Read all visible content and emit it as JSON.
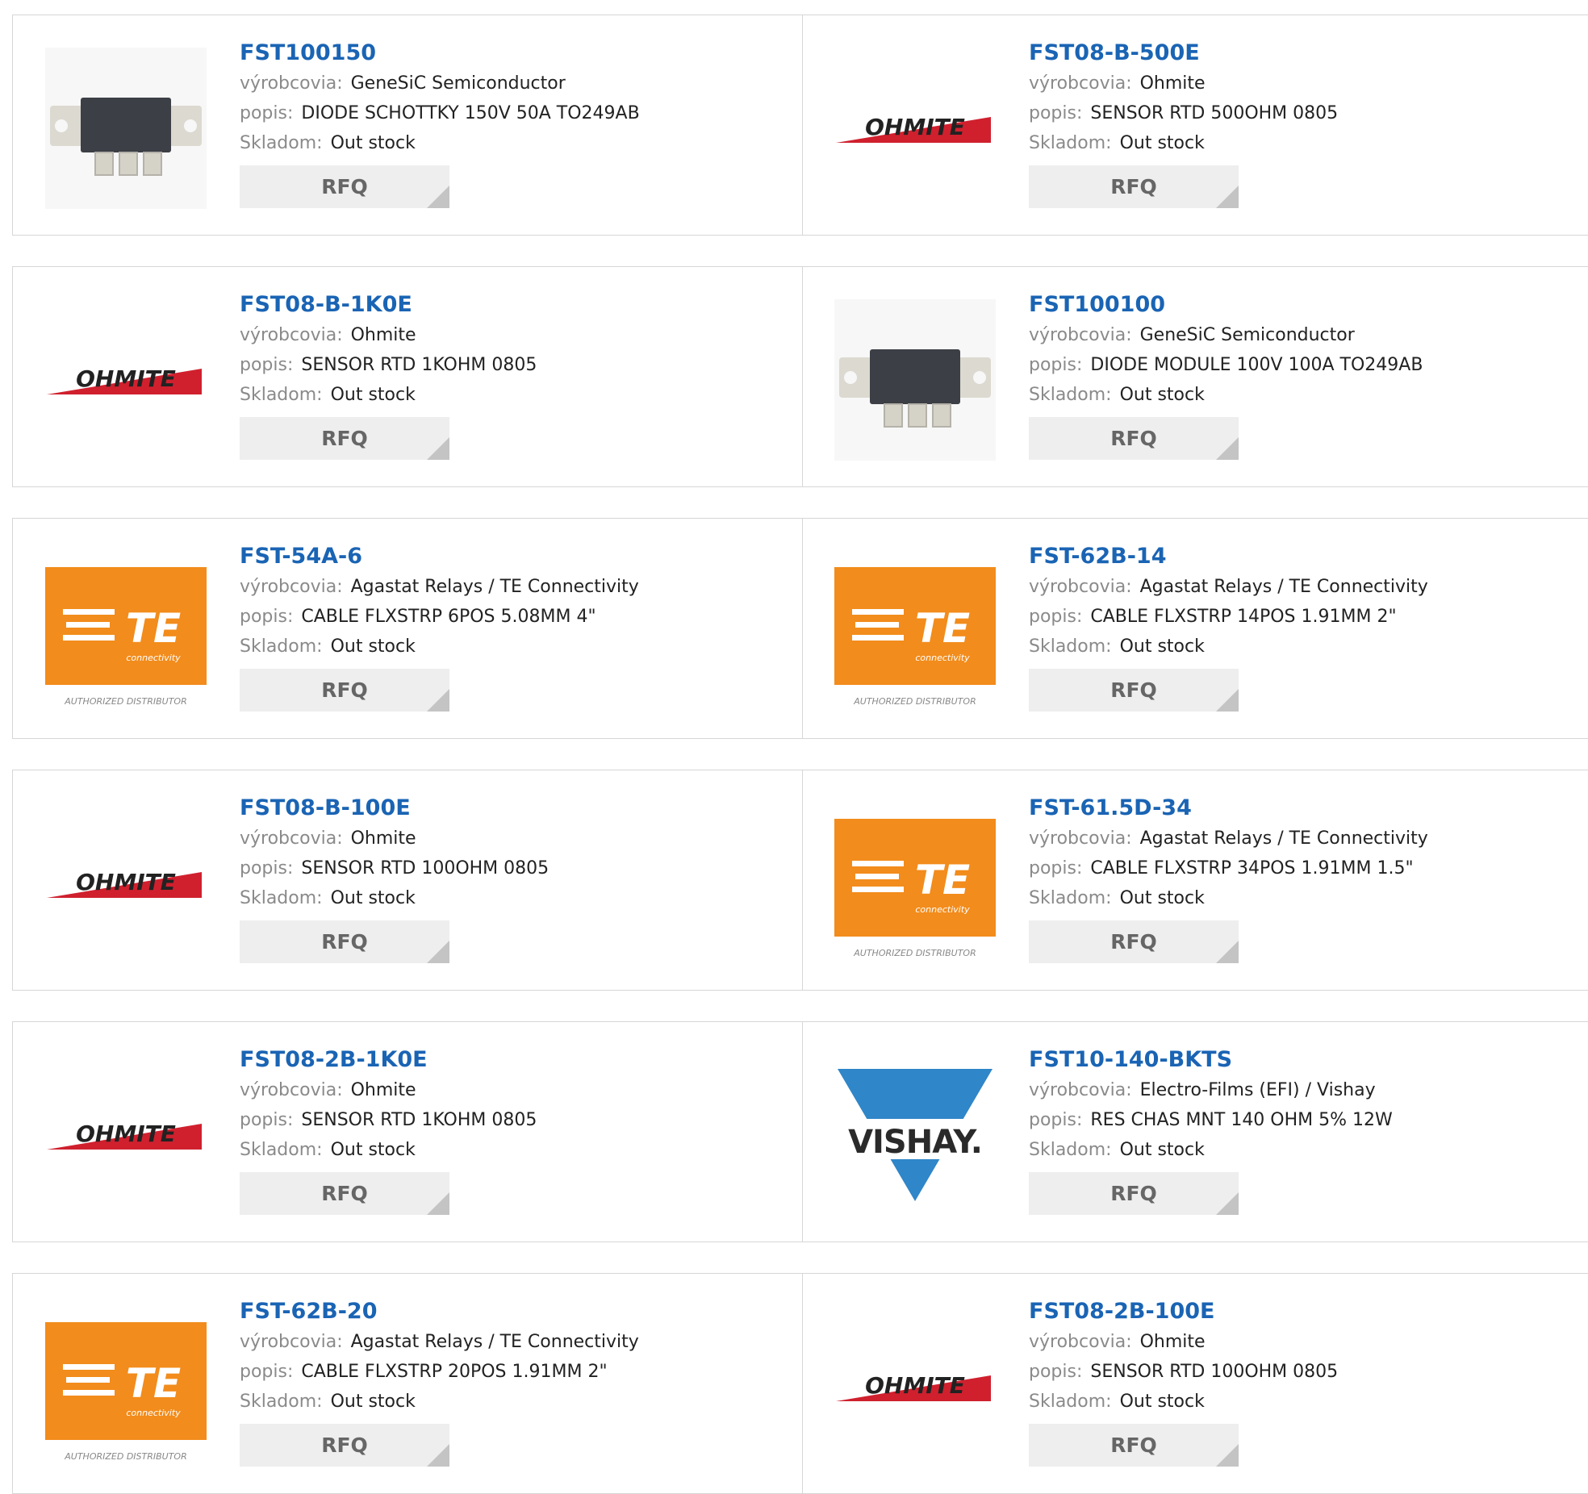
{
  "labels": {
    "manufacturer": "výrobcovia:",
    "description": "popis:",
    "stock": "Skladom:",
    "rfq": "RFQ"
  },
  "logos": {
    "ohmite": "OHMITE",
    "te": "TE",
    "te_sub": "connectivity",
    "te_caption": "AUTHORIZED DISTRIBUTOR",
    "vishay": "VISHAY."
  },
  "colors": {
    "link": "#1a64b4",
    "button_bg": "#eeeeee",
    "te_orange": "#f28c1c",
    "ohmite_red": "#d0202e",
    "vishay_blue": "#2f86c8"
  },
  "products": [
    {
      "pn": "FST100150",
      "manufacturer": "GeneSiC Semiconductor",
      "description": "DIODE SCHOTTKY 150V 50A TO249AB",
      "stock": "Out stock",
      "image": "diode-module"
    },
    {
      "pn": "FST08-B-500E",
      "manufacturer": "Ohmite",
      "description": "SENSOR RTD 500OHM 0805",
      "stock": "Out stock",
      "image": "ohmite-logo"
    },
    {
      "pn": "FST08-B-1K0E",
      "manufacturer": "Ohmite",
      "description": "SENSOR RTD 1KOHM 0805",
      "stock": "Out stock",
      "image": "ohmite-logo"
    },
    {
      "pn": "FST100100",
      "manufacturer": "GeneSiC Semiconductor",
      "description": "DIODE MODULE 100V 100A TO249AB",
      "stock": "Out stock",
      "image": "diode-module"
    },
    {
      "pn": "FST-54A-6",
      "manufacturer": "Agastat Relays / TE Connectivity",
      "description": "CABLE FLXSTRP 6POS 5.08MM 4\"",
      "stock": "Out stock",
      "image": "te-logo"
    },
    {
      "pn": "FST-62B-14",
      "manufacturer": "Agastat Relays / TE Connectivity",
      "description": "CABLE FLXSTRP 14POS 1.91MM 2\"",
      "stock": "Out stock",
      "image": "te-logo"
    },
    {
      "pn": "FST08-B-100E",
      "manufacturer": "Ohmite",
      "description": "SENSOR RTD 100OHM 0805",
      "stock": "Out stock",
      "image": "ohmite-logo"
    },
    {
      "pn": "FST-61.5D-34",
      "manufacturer": "Agastat Relays / TE Connectivity",
      "description": "CABLE FLXSTRP 34POS 1.91MM 1.5\"",
      "stock": "Out stock",
      "image": "te-logo"
    },
    {
      "pn": "FST08-2B-1K0E",
      "manufacturer": "Ohmite",
      "description": "SENSOR RTD 1KOHM 0805",
      "stock": "Out stock",
      "image": "ohmite-logo"
    },
    {
      "pn": "FST10-140-BKTS",
      "manufacturer": "Electro-Films (EFI) / Vishay",
      "description": "RES CHAS MNT 140 OHM 5% 12W",
      "stock": "Out stock",
      "image": "vishay-logo"
    },
    {
      "pn": "FST-62B-20",
      "manufacturer": "Agastat Relays / TE Connectivity",
      "description": "CABLE FLXSTRP 20POS 1.91MM 2\"",
      "stock": "Out stock",
      "image": "te-logo"
    },
    {
      "pn": "FST08-2B-100E",
      "manufacturer": "Ohmite",
      "description": "SENSOR RTD 100OHM 0805",
      "stock": "Out stock",
      "image": "ohmite-logo"
    }
  ]
}
